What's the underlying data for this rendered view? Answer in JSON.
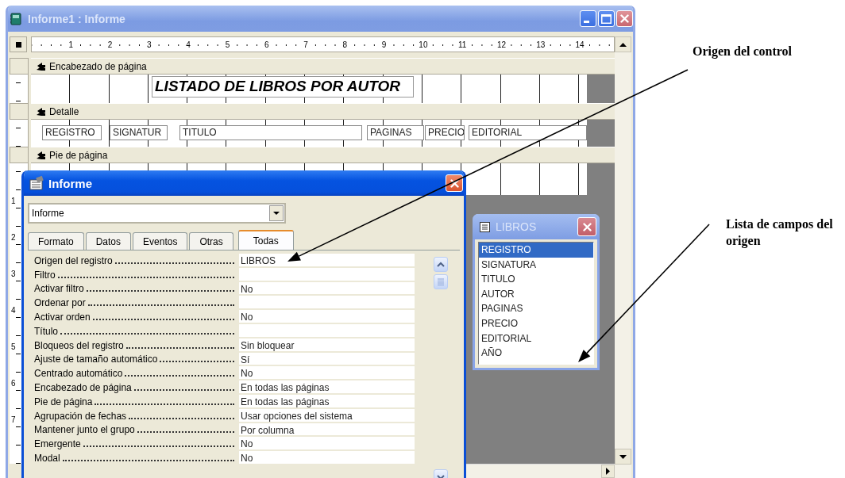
{
  "report_window": {
    "title": "Informe1 : Informe",
    "ruler": [
      "1",
      "2",
      "3",
      "4",
      "5",
      "6",
      "7",
      "8",
      "9",
      "10",
      "11",
      "12",
      "13",
      "14"
    ],
    "vertical_ruler": [
      "1",
      "2",
      "3",
      "4",
      "5",
      "6",
      "7"
    ],
    "sections": [
      {
        "title": "Encabezado de página",
        "controls": [
          {
            "kind": "label",
            "text": "LISTADO DE LIBROS POR AUTOR"
          }
        ]
      },
      {
        "title": "Detalle",
        "controls": [
          {
            "kind": "textbox",
            "text": "REGISTRO"
          },
          {
            "kind": "textbox",
            "text": "SIGNATUR"
          },
          {
            "kind": "textbox",
            "text": "TITULO"
          },
          {
            "kind": "textbox",
            "text": "PAGINAS"
          },
          {
            "kind": "textbox",
            "text": "PRECIO"
          },
          {
            "kind": "textbox",
            "text": "EDITORIAL"
          }
        ]
      },
      {
        "title": "Pie de página"
      }
    ]
  },
  "property_sheet": {
    "title": "Informe",
    "object_selector": "Informe",
    "tabs": [
      {
        "label": "Formato",
        "selected": false
      },
      {
        "label": "Datos",
        "selected": false
      },
      {
        "label": "Eventos",
        "selected": false
      },
      {
        "label": "Otras",
        "selected": false
      },
      {
        "label": "Todas",
        "selected": true
      }
    ],
    "properties": [
      {
        "name": "Origen del registro",
        "value": "LIBROS"
      },
      {
        "name": "Filtro"
      },
      {
        "name": "Activar filtro",
        "value": "No"
      },
      {
        "name": "Ordenar por"
      },
      {
        "name": "Activar orden",
        "value": "No"
      },
      {
        "name": "Título"
      },
      {
        "name": "Bloqueos del registro",
        "value": "Sin bloquear"
      },
      {
        "name": "Ajuste de tamaño automático",
        "value": "Sí"
      },
      {
        "name": "Centrado automático",
        "value": "No"
      },
      {
        "name": "Encabezado de página",
        "value": "En todas las páginas"
      },
      {
        "name": "Pie de página",
        "value": "En todas las páginas"
      },
      {
        "name": "Agrupación de fechas",
        "value": "Usar opciones del sistema"
      },
      {
        "name": "Mantener junto el grupo",
        "value": "Por columna"
      },
      {
        "name": "Emergente",
        "value": "No"
      },
      {
        "name": "Modal",
        "value": "No"
      }
    ]
  },
  "field_list": {
    "title": "LIBROS",
    "fields": [
      {
        "name": "REGISTRO",
        "selected": true
      },
      {
        "name": "SIGNATURA",
        "selected": false
      },
      {
        "name": "TITULO",
        "selected": false
      },
      {
        "name": "AUTOR",
        "selected": false
      },
      {
        "name": "PAGINAS",
        "selected": false
      },
      {
        "name": "PRECIO",
        "selected": false
      },
      {
        "name": "EDITORIAL",
        "selected": false
      },
      {
        "name": "AÑO",
        "selected": false
      }
    ]
  },
  "annotations": [
    {
      "text": "Origen del control"
    },
    {
      "text": "Lista de campos del origen"
    }
  ]
}
